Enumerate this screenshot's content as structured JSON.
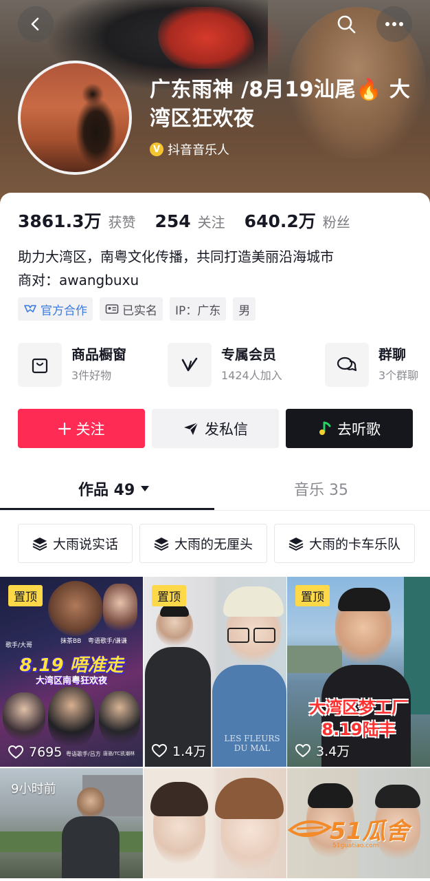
{
  "header": {
    "profile_name": "广东雨神 /8月19汕尾🔥 大湾区狂欢夜",
    "verification": "抖音音乐人"
  },
  "stats": [
    {
      "value": "3861.3万",
      "label": "获赞"
    },
    {
      "value": "254",
      "label": "关注"
    },
    {
      "value": "640.2万",
      "label": "粉丝"
    }
  ],
  "bio": {
    "line1": "助力大湾区，南粤文化传播，共同打造美丽沿海城市",
    "line2": "商对：awangbuxu"
  },
  "tags": {
    "official": "官方合作",
    "verified": "已实名",
    "ip": "IP：广东",
    "gender": "男"
  },
  "features": [
    {
      "title": "商品橱窗",
      "subtitle": "3件好物",
      "icon": "shopping-bag-icon"
    },
    {
      "title": "专属会员",
      "subtitle": "1424人加入",
      "icon": "member-v-icon"
    },
    {
      "title": "群聊",
      "subtitle": "3个群聊",
      "icon": "chat-bubbles-icon"
    }
  ],
  "actions": {
    "follow": "关注",
    "message": "发私信",
    "listen": "去听歌"
  },
  "tabs": {
    "works": "作品 49",
    "music": "音乐 35"
  },
  "collections": [
    "大雨说实话",
    "大雨的无厘头",
    "大雨的卡车乐队"
  ],
  "videos": [
    {
      "pinned": "置顶",
      "likes": "7695",
      "poster": {
        "headline": "8.19 唔准走",
        "sub": "大湾区南粤狂欢夜",
        "tags": [
          "歌手/大哥",
          "抹茶BB",
          "粤语歌手/谦谦",
          "粤语歌手/吕方",
          "唐骆/TC凯潮林"
        ]
      }
    },
    {
      "pinned": "置顶",
      "likes": "1.4万",
      "poster": {
        "shirt_text": "LES FLEURS DU MAL"
      }
    },
    {
      "pinned": "置顶",
      "likes": "3.4万",
      "poster": {
        "headline": "大湾区梦工厂",
        "sub": "8.19陆丰"
      }
    },
    {
      "age": "9小时前"
    },
    {},
    {}
  ],
  "watermark": {
    "brand": "51瓜舍",
    "site": "51guatiao.com"
  },
  "colors": {
    "accent": "#fe2c55",
    "dark_button": "#16171c",
    "pin_yellow": "#fdd94a",
    "official_blue": "#3a7be0"
  }
}
